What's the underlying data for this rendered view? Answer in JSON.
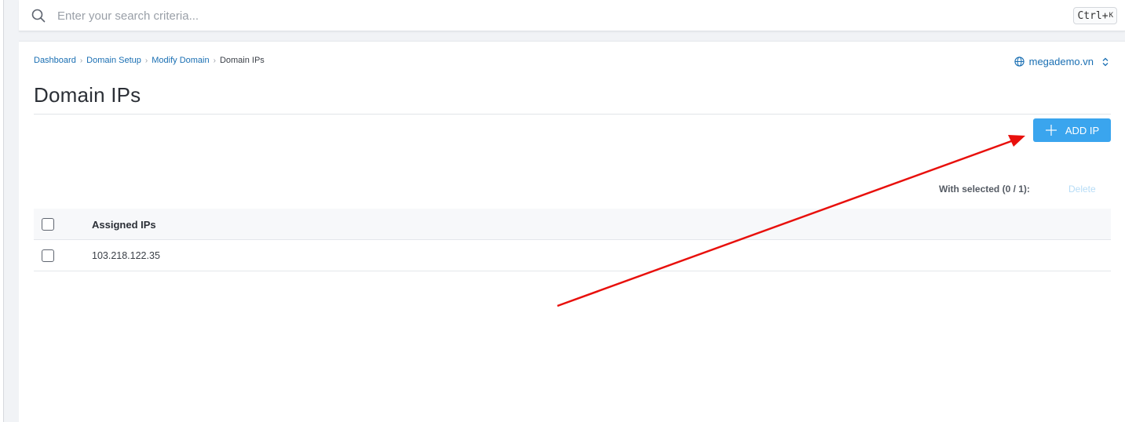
{
  "search": {
    "placeholder": "Enter your search criteria...",
    "shortcut_main": "Ctrl+",
    "shortcut_key": "K"
  },
  "breadcrumb": [
    "Dashboard",
    "Domain Setup",
    "Modify Domain",
    "Domain IPs"
  ],
  "domain_selector": {
    "value": "megademo.vn"
  },
  "page": {
    "title": "Domain IPs"
  },
  "actions": {
    "add_ip_label": "ADD IP"
  },
  "bulk": {
    "with_selected": "With selected (0 / 1):",
    "delete_label": "Delete"
  },
  "table": {
    "column": "Assigned IPs",
    "rows": [
      {
        "ip": "103.218.122.35"
      }
    ]
  },
  "colors": {
    "accent": "#3aa5ee",
    "link": "#1a6fb3",
    "annotation_arrow": "#e8100c"
  }
}
